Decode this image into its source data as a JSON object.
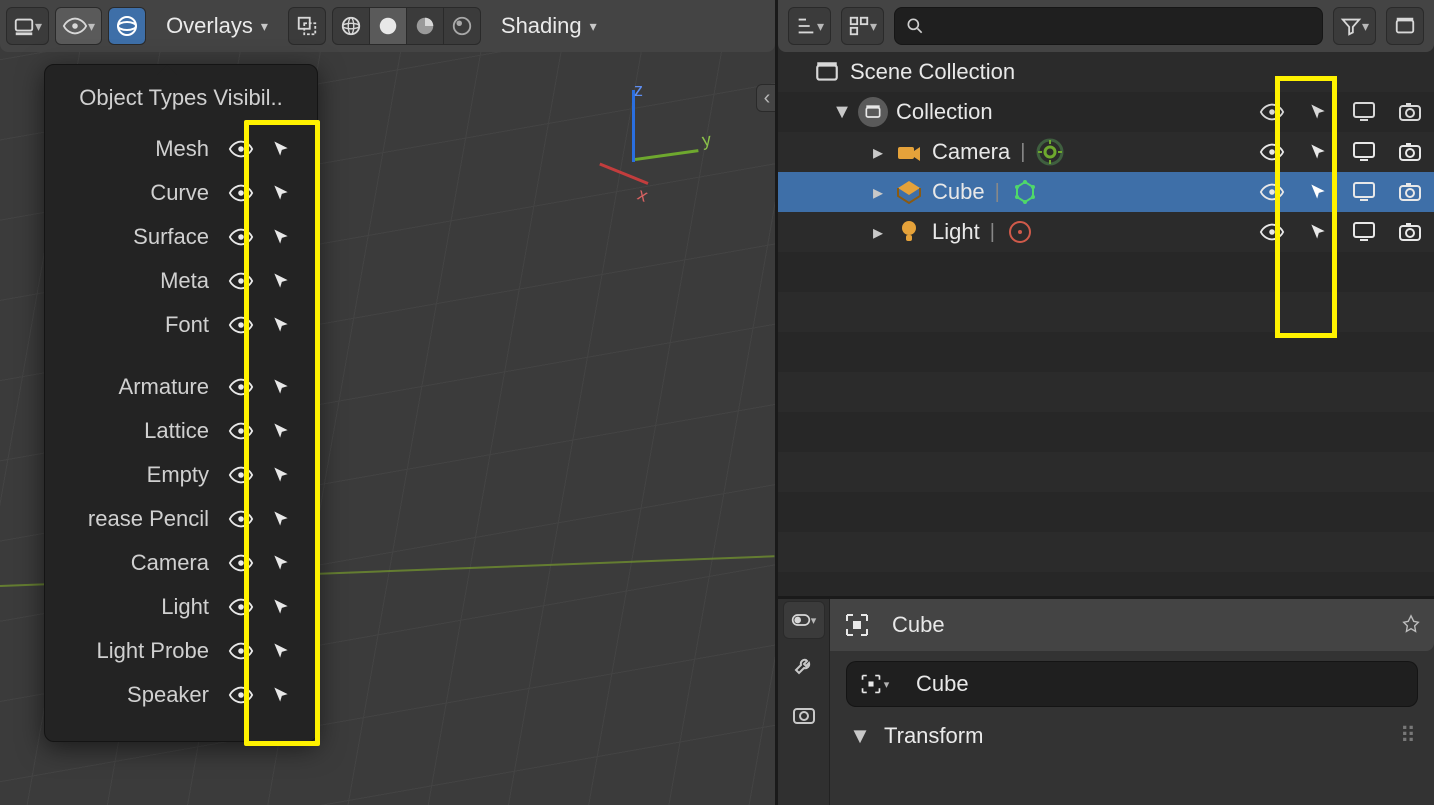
{
  "viewport": {
    "header": {
      "overlays_label": "Overlays",
      "shading_label": "Shading"
    },
    "visibility_popover": {
      "title": "Object Types Visibil..",
      "group1": [
        "Mesh",
        "Curve",
        "Surface",
        "Meta",
        "Font"
      ],
      "group2": [
        "Armature",
        "Lattice",
        "Empty",
        "rease Pencil",
        "Camera",
        "Light",
        "Light Probe",
        "Speaker"
      ]
    }
  },
  "outliner": {
    "scene_collection": "Scene Collection",
    "collection": "Collection",
    "items": [
      {
        "name": "Camera",
        "type": "camera",
        "selected": false
      },
      {
        "name": "Cube",
        "type": "mesh",
        "selected": true
      },
      {
        "name": "Light",
        "type": "light",
        "selected": false
      }
    ],
    "search_placeholder": ""
  },
  "properties": {
    "object_name": "Cube",
    "name_field_value": "Cube",
    "panel_title": "Transform"
  }
}
